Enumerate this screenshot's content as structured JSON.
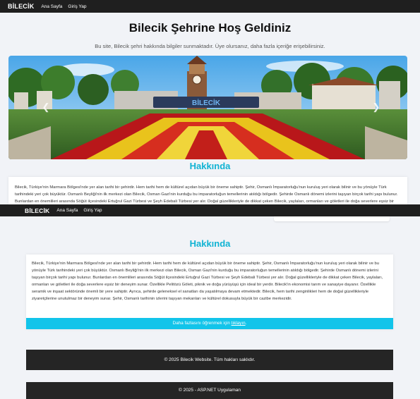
{
  "nav": {
    "brand": "BİLECİK",
    "links": [
      "Ana Sayfa",
      "Giriş Yap"
    ]
  },
  "hero": {
    "title": "Bilecik Şehrine Hoş Geldiniz",
    "subtitle": "Bu site, Bilecik şehri hakkında bilgiler sunmaktadır. Üye olursanız, daha fazla içeriğe erişebilirsiniz."
  },
  "carousel": {
    "sign_text": "BİLECİK",
    "prev_icon": "chevron-left-icon",
    "next_icon": "chevron-right-icon"
  },
  "about": {
    "title": "Hakkında",
    "text": "Bilecik, Türkiye'nin Marmara Bölgesi'nde yer alan tarihi bir şehirdir. Hem tarihi hem de kültürel açıdan büyük bir öneme sahiptir. Şehir, Osmanlı İmparatorluğu'nun kuruluş yeri olarak bilinir ve bu yönüyle Türk tarihindeki yeri çok büyüktür. Osmanlı Beyliği'nin ilk merkezi olan Bilecik, Osman Gazi'nin kurduğu bu imparatorluğun temellerinin atıldığı bölgedir. Şehirde Osmanlı dönemi izlerini taşıyan birçok tarihi yapı bulunur. Bunlardan en önemlileri arasında Söğüt ilçesindeki Ertuğrul Gazi Türbesi ve Şeyh Edebali Türbesi yer alır. Doğal güzellikleriyle de dikkat çeken Bilecik, yaylaları, ormanları ve göletleri ile doğa severlere eşsiz bir deneyim sunar. Özellikle Pelitözü Göleti, piknik ve doğa yürüyüşü için ideal bir yerdir. Bilecik'in ekonomisi tarım ve sanayiye dayanır. Özellikle seramik ve inşaat sektöründe önemli bir yere sahiptir. Ayrıca, şehirde geleneksel el sanatları da yaşatılmaya devam etmektedir. Bilecik, hem tarihi zenginlikleri hem de doğal güzellikleriyle ziyaretçilerine unutulmaz bir deneyim sunar. Şehir, Osmanlı tarihinin izlerini taşıyan mekanları ve kültürel dokusuyla büyük bir cazibe merkezidir.",
    "info_prefix": "Daha fazlasını öğrenmek için ",
    "info_link": "tıklayın",
    "info_suffix": "."
  },
  "footer": {
    "copyright": "© 2025 Bilecik Website. Tüm hakları saklıdır.",
    "app": "© 2025 - ASP.NET Uygulaman"
  },
  "colors": {
    "accent": "#12c4ea",
    "navbar": "#1f1f1f",
    "footer": "#252525"
  }
}
